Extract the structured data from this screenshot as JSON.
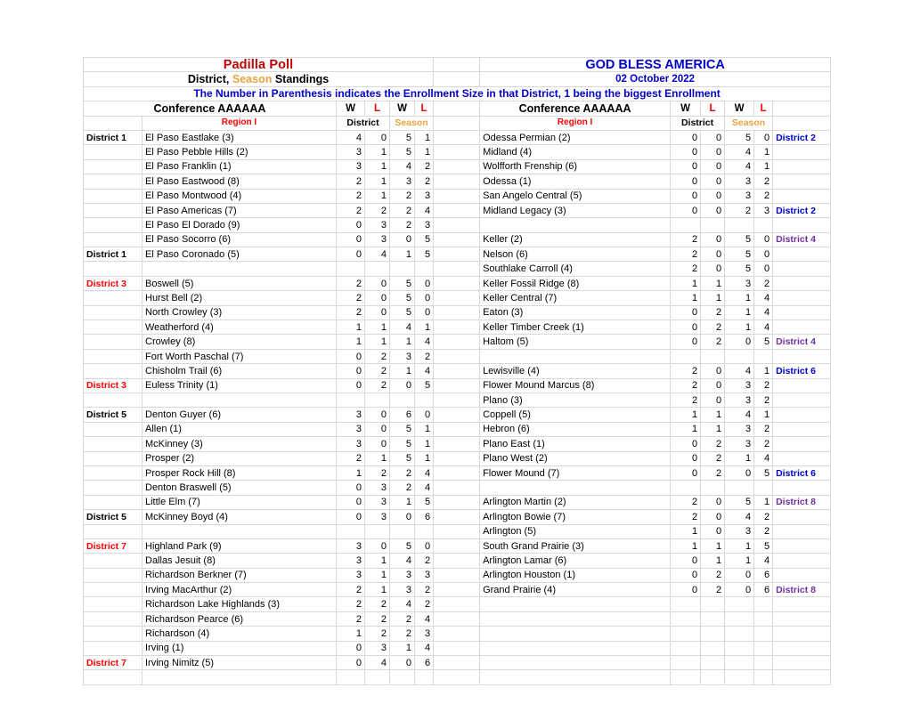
{
  "header": {
    "title_left": "Padilla Poll",
    "title_right": "GOD BLESS AMERICA",
    "subtitle_left_part1": "District,",
    "subtitle_left_part2": "Season",
    "subtitle_left_part3": "Standings",
    "date_right": "02 October 2022",
    "banner": "The Number in Parenthesis indicates the Enrollment Size in that District, 1 being the biggest Enrollment",
    "conference_left": "Conference AAAAAA",
    "conference_right": "Conference AAAAAA",
    "region_left": "Region I",
    "region_right": "Region I",
    "w": "W",
    "l": "L",
    "segment_district": "District",
    "segment_season": "Season"
  },
  "colors": {
    "title_red": "#c00000",
    "title_blue": "#0000cc",
    "loss_red": "#ff0000",
    "season_orange": "#e8a33d",
    "district_purple": "#7030a0",
    "gridline": "#d9d9d9"
  },
  "left_rows": [
    {
      "district": "District 1",
      "dcolor": "black",
      "team": "El Paso Eastlake (3)",
      "dw": "4",
      "dl": "0",
      "sw": "5",
      "sl": "1"
    },
    {
      "district": "",
      "dcolor": "black",
      "team": "El Paso Pebble Hills (2)",
      "dw": "3",
      "dl": "1",
      "sw": "5",
      "sl": "1"
    },
    {
      "district": "",
      "dcolor": "black",
      "team": "El Paso Franklin (1)",
      "dw": "3",
      "dl": "1",
      "sw": "4",
      "sl": "2"
    },
    {
      "district": "",
      "dcolor": "black",
      "team": "El Paso Eastwood (8)",
      "dw": "2",
      "dl": "1",
      "sw": "3",
      "sl": "2"
    },
    {
      "district": "",
      "dcolor": "black",
      "team": "El Paso Montwood (4)",
      "dw": "2",
      "dl": "1",
      "sw": "2",
      "sl": "3"
    },
    {
      "district": "",
      "dcolor": "black",
      "team": "El Paso Americas (7)",
      "dw": "2",
      "dl": "2",
      "sw": "2",
      "sl": "4"
    },
    {
      "district": "",
      "dcolor": "black",
      "team": "El Paso El Dorado (9)",
      "dw": "0",
      "dl": "3",
      "sw": "2",
      "sl": "3"
    },
    {
      "district": "",
      "dcolor": "black",
      "team": "El Paso Socorro (6)",
      "dw": "0",
      "dl": "3",
      "sw": "0",
      "sl": "5"
    },
    {
      "district": "District 1",
      "dcolor": "black",
      "team": "El Paso Coronado (5)",
      "dw": "0",
      "dl": "4",
      "sw": "1",
      "sl": "5"
    },
    {
      "district": "",
      "dcolor": "black",
      "team": "",
      "dw": "",
      "dl": "",
      "sw": "",
      "sl": ""
    },
    {
      "district": "District 3",
      "dcolor": "red",
      "team": "Boswell (5)",
      "dw": "2",
      "dl": "0",
      "sw": "5",
      "sl": "0"
    },
    {
      "district": "",
      "dcolor": "black",
      "team": "Hurst Bell (2)",
      "dw": "2",
      "dl": "0",
      "sw": "5",
      "sl": "0"
    },
    {
      "district": "",
      "dcolor": "black",
      "team": "North Crowley (3)",
      "dw": "2",
      "dl": "0",
      "sw": "5",
      "sl": "0"
    },
    {
      "district": "",
      "dcolor": "black",
      "team": "Weatherford (4)",
      "dw": "1",
      "dl": "1",
      "sw": "4",
      "sl": "1"
    },
    {
      "district": "",
      "dcolor": "black",
      "team": "Crowley (8)",
      "dw": "1",
      "dl": "1",
      "sw": "1",
      "sl": "4"
    },
    {
      "district": "",
      "dcolor": "black",
      "team": "Fort Worth Paschal (7)",
      "dw": "0",
      "dl": "2",
      "sw": "3",
      "sl": "2"
    },
    {
      "district": "",
      "dcolor": "black",
      "team": "Chisholm Trail (6)",
      "dw": "0",
      "dl": "2",
      "sw": "1",
      "sl": "4"
    },
    {
      "district": "District 3",
      "dcolor": "red",
      "team": "Euless Trinity (1)",
      "dw": "0",
      "dl": "2",
      "sw": "0",
      "sl": "5"
    },
    {
      "district": "",
      "dcolor": "black",
      "team": "",
      "dw": "",
      "dl": "",
      "sw": "",
      "sl": ""
    },
    {
      "district": "District 5",
      "dcolor": "black",
      "team": "Denton Guyer (6)",
      "dw": "3",
      "dl": "0",
      "sw": "6",
      "sl": "0"
    },
    {
      "district": "",
      "dcolor": "black",
      "team": "Allen (1)",
      "dw": "3",
      "dl": "0",
      "sw": "5",
      "sl": "1"
    },
    {
      "district": "",
      "dcolor": "black",
      "team": "McKinney (3)",
      "dw": "3",
      "dl": "0",
      "sw": "5",
      "sl": "1"
    },
    {
      "district": "",
      "dcolor": "black",
      "team": "Prosper (2)",
      "dw": "2",
      "dl": "1",
      "sw": "5",
      "sl": "1"
    },
    {
      "district": "",
      "dcolor": "black",
      "team": "Prosper Rock Hill (8)",
      "dw": "1",
      "dl": "2",
      "sw": "2",
      "sl": "4"
    },
    {
      "district": "",
      "dcolor": "black",
      "team": "Denton Braswell (5)",
      "dw": "0",
      "dl": "3",
      "sw": "2",
      "sl": "4"
    },
    {
      "district": "",
      "dcolor": "black",
      "team": "Little Elm (7)",
      "dw": "0",
      "dl": "3",
      "sw": "1",
      "sl": "5"
    },
    {
      "district": "District 5",
      "dcolor": "black",
      "team": "McKinney Boyd (4)",
      "dw": "0",
      "dl": "3",
      "sw": "0",
      "sl": "6"
    },
    {
      "district": "",
      "dcolor": "black",
      "team": "",
      "dw": "",
      "dl": "",
      "sw": "",
      "sl": ""
    },
    {
      "district": "District 7",
      "dcolor": "red",
      "team": "Highland Park (9)",
      "dw": "3",
      "dl": "0",
      "sw": "5",
      "sl": "0"
    },
    {
      "district": "",
      "dcolor": "black",
      "team": "Dallas Jesuit (8)",
      "dw": "3",
      "dl": "1",
      "sw": "4",
      "sl": "2"
    },
    {
      "district": "",
      "dcolor": "black",
      "team": "Richardson Berkner (7)",
      "dw": "3",
      "dl": "1",
      "sw": "3",
      "sl": "3"
    },
    {
      "district": "",
      "dcolor": "black",
      "team": "Irving MacArthur (2)",
      "dw": "2",
      "dl": "1",
      "sw": "3",
      "sl": "2"
    },
    {
      "district": "",
      "dcolor": "black",
      "team": "Richardson Lake Highlands (3)",
      "dw": "2",
      "dl": "2",
      "sw": "4",
      "sl": "2"
    },
    {
      "district": "",
      "dcolor": "black",
      "team": "Richardson Pearce (6)",
      "dw": "2",
      "dl": "2",
      "sw": "2",
      "sl": "4"
    },
    {
      "district": "",
      "dcolor": "black",
      "team": "Richardson (4)",
      "dw": "1",
      "dl": "2",
      "sw": "2",
      "sl": "3"
    },
    {
      "district": "",
      "dcolor": "black",
      "team": "Irving (1)",
      "dw": "0",
      "dl": "3",
      "sw": "1",
      "sl": "4"
    },
    {
      "district": "District 7",
      "dcolor": "red",
      "team": "Irving Nimitz (5)",
      "dw": "0",
      "dl": "4",
      "sw": "0",
      "sl": "6"
    },
    {
      "district": "",
      "dcolor": "black",
      "team": "",
      "dw": "",
      "dl": "",
      "sw": "",
      "sl": ""
    }
  ],
  "right_rows": [
    {
      "team": "Odessa Permian (2)",
      "dw": "0",
      "dl": "0",
      "sw": "5",
      "sl": "0",
      "district": "District 2",
      "dcolor": "blue"
    },
    {
      "team": "Midland (4)",
      "dw": "0",
      "dl": "0",
      "sw": "4",
      "sl": "1",
      "district": "",
      "dcolor": "blue"
    },
    {
      "team": "Wolfforth Frenship (6)",
      "dw": "0",
      "dl": "0",
      "sw": "4",
      "sl": "1",
      "district": "",
      "dcolor": "blue"
    },
    {
      "team": "Odessa (1)",
      "dw": "0",
      "dl": "0",
      "sw": "3",
      "sl": "2",
      "district": "",
      "dcolor": "blue"
    },
    {
      "team": "San Angelo Central (5)",
      "dw": "0",
      "dl": "0",
      "sw": "3",
      "sl": "2",
      "district": "",
      "dcolor": "blue"
    },
    {
      "team": "Midland Legacy (3)",
      "dw": "0",
      "dl": "0",
      "sw": "2",
      "sl": "3",
      "district": "District 2",
      "dcolor": "blue"
    },
    {
      "team": "",
      "dw": "",
      "dl": "",
      "sw": "",
      "sl": "",
      "district": "",
      "dcolor": "blue"
    },
    {
      "team": "Keller (2)",
      "dw": "2",
      "dl": "0",
      "sw": "5",
      "sl": "0",
      "district": "District 4",
      "dcolor": "purple"
    },
    {
      "team": "Nelson (6)",
      "dw": "2",
      "dl": "0",
      "sw": "5",
      "sl": "0",
      "district": "",
      "dcolor": "purple"
    },
    {
      "team": "Southlake Carroll (4)",
      "dw": "2",
      "dl": "0",
      "sw": "5",
      "sl": "0",
      "district": "",
      "dcolor": "purple"
    },
    {
      "team": "Keller Fossil Ridge (8)",
      "dw": "1",
      "dl": "1",
      "sw": "3",
      "sl": "2",
      "district": "",
      "dcolor": "purple"
    },
    {
      "team": "Keller Central (7)",
      "dw": "1",
      "dl": "1",
      "sw": "1",
      "sl": "4",
      "district": "",
      "dcolor": "purple"
    },
    {
      "team": "Eaton (3)",
      "dw": "0",
      "dl": "2",
      "sw": "1",
      "sl": "4",
      "district": "",
      "dcolor": "purple"
    },
    {
      "team": "Keller Timber Creek (1)",
      "dw": "0",
      "dl": "2",
      "sw": "1",
      "sl": "4",
      "district": "",
      "dcolor": "purple"
    },
    {
      "team": "Haltom (5)",
      "dw": "0",
      "dl": "2",
      "sw": "0",
      "sl": "5",
      "district": "District 4",
      "dcolor": "purple"
    },
    {
      "team": "",
      "dw": "",
      "dl": "",
      "sw": "",
      "sl": "",
      "district": "",
      "dcolor": "blue"
    },
    {
      "team": "Lewisville (4)",
      "dw": "2",
      "dl": "0",
      "sw": "4",
      "sl": "1",
      "district": "District 6",
      "dcolor": "blue"
    },
    {
      "team": "Flower Mound Marcus (8)",
      "dw": "2",
      "dl": "0",
      "sw": "3",
      "sl": "2",
      "district": "",
      "dcolor": "blue"
    },
    {
      "team": "Plano (3)",
      "dw": "2",
      "dl": "0",
      "sw": "3",
      "sl": "2",
      "district": "",
      "dcolor": "blue"
    },
    {
      "team": "Coppell (5)",
      "dw": "1",
      "dl": "1",
      "sw": "4",
      "sl": "1",
      "district": "",
      "dcolor": "blue"
    },
    {
      "team": "Hebron (6)",
      "dw": "1",
      "dl": "1",
      "sw": "3",
      "sl": "2",
      "district": "",
      "dcolor": "blue"
    },
    {
      "team": "Plano East (1)",
      "dw": "0",
      "dl": "2",
      "sw": "3",
      "sl": "2",
      "district": "",
      "dcolor": "blue"
    },
    {
      "team": "Plano West (2)",
      "dw": "0",
      "dl": "2",
      "sw": "1",
      "sl": "4",
      "district": "",
      "dcolor": "blue"
    },
    {
      "team": "Flower Mound (7)",
      "dw": "0",
      "dl": "2",
      "sw": "0",
      "sl": "5",
      "district": "District 6",
      "dcolor": "blue"
    },
    {
      "team": "",
      "dw": "",
      "dl": "",
      "sw": "",
      "sl": "",
      "district": "",
      "dcolor": "blue"
    },
    {
      "team": "Arlington Martin (2)",
      "dw": "2",
      "dl": "0",
      "sw": "5",
      "sl": "1",
      "district": "District 8",
      "dcolor": "purple"
    },
    {
      "team": "Arlington Bowie (7)",
      "dw": "2",
      "dl": "0",
      "sw": "4",
      "sl": "2",
      "district": "",
      "dcolor": "purple"
    },
    {
      "team": "Arlington (5)",
      "dw": "1",
      "dl": "0",
      "sw": "3",
      "sl": "2",
      "district": "",
      "dcolor": "purple"
    },
    {
      "team": "South Grand Prairie (3)",
      "dw": "1",
      "dl": "1",
      "sw": "1",
      "sl": "5",
      "district": "",
      "dcolor": "purple"
    },
    {
      "team": "Arlington Lamar (6)",
      "dw": "0",
      "dl": "1",
      "sw": "1",
      "sl": "4",
      "district": "",
      "dcolor": "purple"
    },
    {
      "team": "Arlington Houston (1)",
      "dw": "0",
      "dl": "2",
      "sw": "0",
      "sl": "6",
      "district": "",
      "dcolor": "purple"
    },
    {
      "team": "Grand Prairie (4)",
      "dw": "0",
      "dl": "2",
      "sw": "0",
      "sl": "6",
      "district": "District 8",
      "dcolor": "purple"
    },
    {
      "team": "",
      "dw": "",
      "dl": "",
      "sw": "",
      "sl": "",
      "district": "",
      "dcolor": "blue"
    },
    {
      "team": "",
      "dw": "",
      "dl": "",
      "sw": "",
      "sl": "",
      "district": "",
      "dcolor": "blue"
    },
    {
      "team": "",
      "dw": "",
      "dl": "",
      "sw": "",
      "sl": "",
      "district": "",
      "dcolor": "blue"
    },
    {
      "team": "",
      "dw": "",
      "dl": "",
      "sw": "",
      "sl": "",
      "district": "",
      "dcolor": "blue"
    },
    {
      "team": "",
      "dw": "",
      "dl": "",
      "sw": "",
      "sl": "",
      "district": "",
      "dcolor": "blue"
    },
    {
      "team": "",
      "dw": "",
      "dl": "",
      "sw": "",
      "sl": "",
      "district": "",
      "dcolor": "blue"
    }
  ]
}
